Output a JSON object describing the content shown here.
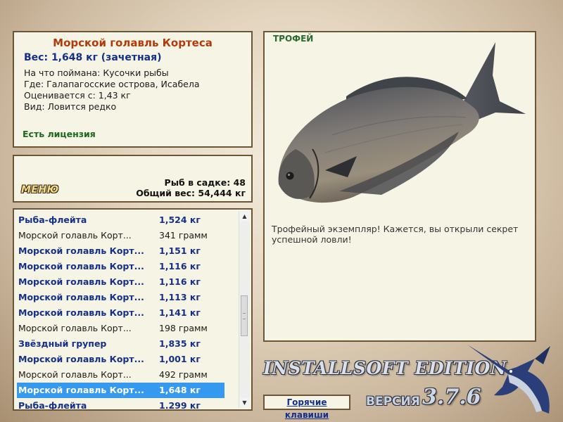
{
  "info": {
    "title": "Морской голавль Кортеса",
    "weight": "Вес: 1,648 кг (зачетная)",
    "bait": "На что поймана: Кусочки рыбы",
    "location": "Где: Галапагосские острова, Исабела",
    "valued": "Оценивается с: 1,43 кг",
    "rarity": "Вид: Ловится редко",
    "license": "Есть лицензия"
  },
  "menu": {
    "button": "МЕНЮ",
    "fish_in_keepnet": "Рыб в садке: 48",
    "total_weight": "Общий вес: 54,444 кг"
  },
  "list": {
    "items": [
      {
        "name": "Рыба-флейта",
        "weight": "1,524 кг",
        "style": "bold"
      },
      {
        "name": "Морской голавль Корт...",
        "weight": "341 грамм",
        "style": "norm"
      },
      {
        "name": "Морской голавль Корт...",
        "weight": "1,151 кг",
        "style": "bold"
      },
      {
        "name": "Морской голавль Корт...",
        "weight": "1,116 кг",
        "style": "bold"
      },
      {
        "name": "Морской голавль Корт...",
        "weight": "1,116 кг",
        "style": "bold"
      },
      {
        "name": "Морской голавль Корт...",
        "weight": "1,113 кг",
        "style": "bold"
      },
      {
        "name": "Морской голавль Корт...",
        "weight": "1,141 кг",
        "style": "bold"
      },
      {
        "name": "Морской голавль Корт...",
        "weight": "198 грамм",
        "style": "norm"
      },
      {
        "name": "Звёздный групер",
        "weight": "1,835 кг",
        "style": "bold"
      },
      {
        "name": "Морской голавль Корт...",
        "weight": "1,001 кг",
        "style": "bold"
      },
      {
        "name": "Морской голавль Корт...",
        "weight": "492 грамм",
        "style": "norm"
      },
      {
        "name": "Морской голавль Корт...",
        "weight": "1,648 кг",
        "style": "sel"
      },
      {
        "name": "Рыба-флейта",
        "weight": "1.299 кг",
        "style": "bold"
      }
    ]
  },
  "trophy": {
    "tag": "ТРОФЕЙ",
    "message": "Трофейный экземпляр! Кажется, вы открыли секрет успешной ловли!"
  },
  "footer": {
    "hotkeys": "Горячие клавиши",
    "edition": "INSTALLSOFT EDITION",
    "version_label": "ВЕРСИЯ",
    "version_number": "3.7.6"
  },
  "colors": {
    "panel_bg": "#f6f5e5",
    "panel_border": "#6b5535",
    "title_red": "#b23a0a",
    "link_blue": "#152f8a",
    "license_green": "#1a6a1a",
    "selection_blue": "#3599f0"
  },
  "icons": [
    "fish-image",
    "marlin-logo",
    "scroll-up-icon",
    "scroll-down-icon"
  ]
}
